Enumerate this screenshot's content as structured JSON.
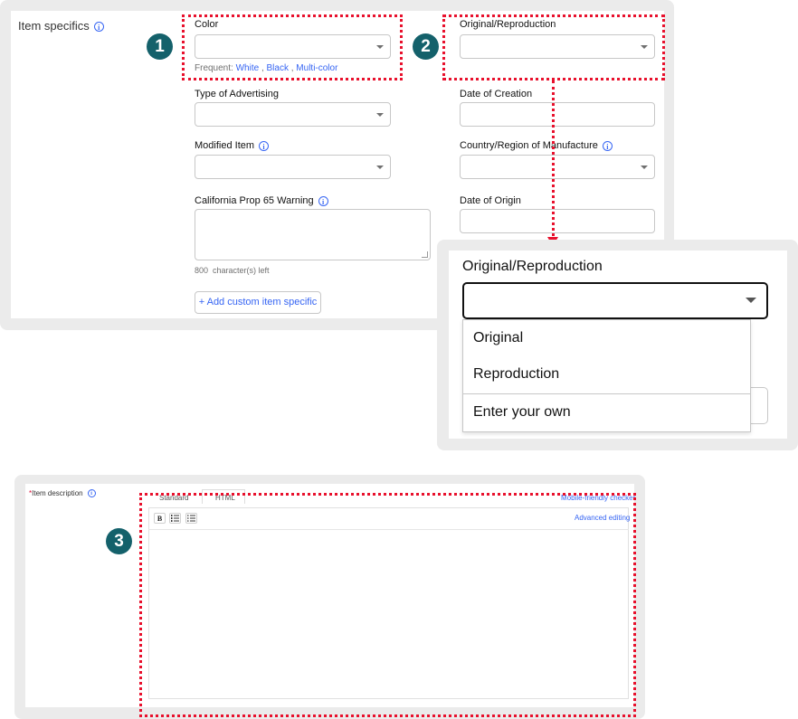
{
  "item_specifics": {
    "section_label": "Item specifics",
    "info_icon": "info-icon",
    "color": {
      "label": "Color",
      "frequent_prefix": "Frequent:",
      "frequent_values": [
        "White",
        "Black",
        "Multi-color"
      ],
      "separator": ","
    },
    "original_reproduction_label": "Original/Reproduction",
    "type_of_advertising_label": "Type of Advertising",
    "date_of_creation_label": "Date of Creation",
    "modified_item_label": "Modified Item",
    "country_label": "Country/Region of Manufacture",
    "california_label": "California Prop 65 Warning",
    "date_of_origin_label": "Date of Origin",
    "char_count": "800  character(s) left",
    "add_custom_label": "+ Add custom item specific"
  },
  "dropdown_zoom": {
    "label": "Original/Reproduction",
    "options": [
      "Original",
      "Reproduction",
      "Enter your own"
    ]
  },
  "item_description": {
    "required_mark": "*",
    "label": "Item description",
    "tabs": [
      "Standard",
      "HTML"
    ],
    "mobile_checker": "Mobile-friendly checker",
    "advanced_editing": "Advanced editing",
    "toolbar": [
      "B",
      "ordered-list-icon",
      "bullet-list-icon"
    ]
  },
  "callouts": [
    "1",
    "2",
    "3"
  ],
  "colors": {
    "accent_link": "#3665f3",
    "callout_badge": "#14616b",
    "highlight_dots": "#e8112d",
    "panel_bg": "#ebebeb"
  }
}
